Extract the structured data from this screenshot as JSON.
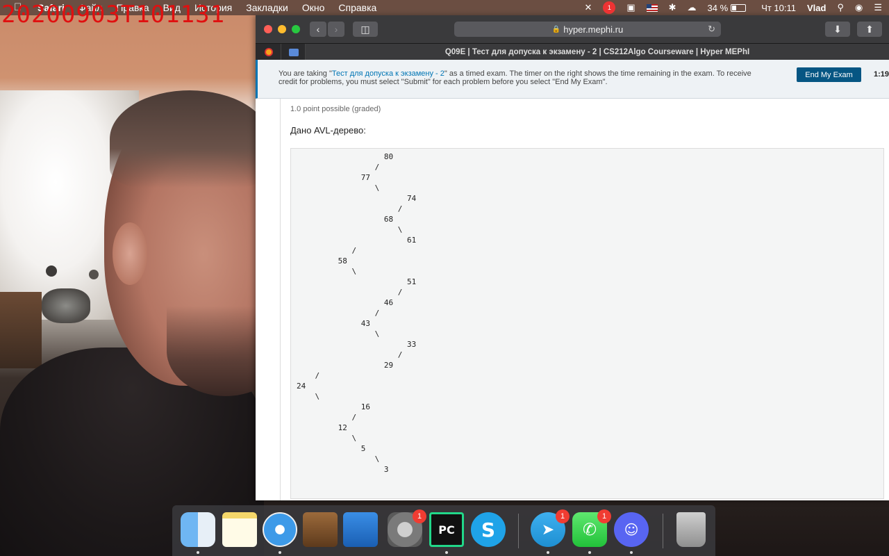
{
  "overlay": {
    "timestamp": "20200903T101131"
  },
  "menubar": {
    "app_name": "Safari",
    "menus": [
      "Файл",
      "Правка",
      "Вид",
      "История",
      "Закладки",
      "Окно",
      "Справка"
    ],
    "status": {
      "badge_count": "1",
      "battery": "34 %",
      "clock": "Чт 10:11",
      "user": "Vlad"
    }
  },
  "browser": {
    "url": "hyper.mephi.ru",
    "tab_title": "Q09E | Тест для допуска к экзамену - 2 | CS212Algo Courseware | Hyper MEPhI"
  },
  "exam_banner": {
    "text_before": "You are taking \"",
    "link_text": "Тест для допуска к экзамену - 2",
    "text_after": "\" as a timed exam. The timer on the right shows the time remaining in the exam. To receive credit for problems, you must select \"Submit\" for each problem before you select \"End My Exam\".",
    "end_button": "End My Exam",
    "timer": "1:19:"
  },
  "problem": {
    "points": "1.0 point possible (graded)",
    "question": "Дано AVL-дерево:",
    "tree_lines": [
      "                   80",
      "                 /",
      "              77",
      "                 \\",
      "                        74",
      "                      /",
      "                   68",
      "                      \\",
      "                        61",
      "            /",
      "         58",
      "            \\",
      "                        51",
      "                      /",
      "                   46",
      "                 /",
      "              43",
      "                 \\",
      "                        33",
      "                      /",
      "                   29",
      "    /",
      "24",
      "    \\",
      "              16",
      "            /",
      "         12",
      "            \\",
      "              5",
      "                 \\",
      "                   3"
    ]
  },
  "dock": {
    "badges": {
      "system_preferences": "1",
      "telegram": "1",
      "facetime": "1"
    },
    "pycharm_label": "PC"
  }
}
